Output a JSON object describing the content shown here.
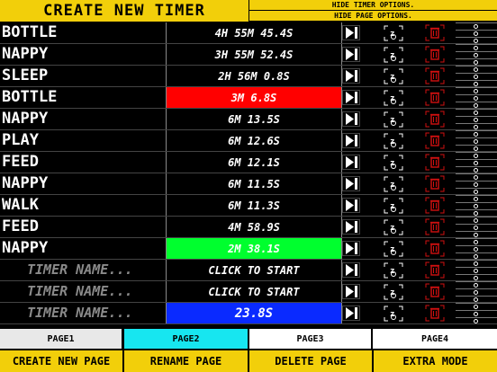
{
  "header": {
    "create_label": "CREATE NEW TIMER",
    "hide_timer_options": "HIDE TIMER OPTIONS.",
    "hide_page_options": "HIDE PAGE OPTIONS."
  },
  "rows": [
    {
      "name": "BOTTLE",
      "time": "4H 55M 45.4S",
      "placeholder": false,
      "highlight": ""
    },
    {
      "name": "NAPPY",
      "time": "3H 55M 52.4S",
      "placeholder": false,
      "highlight": ""
    },
    {
      "name": "SLEEP",
      "time": "2H 56M 0.8S",
      "placeholder": false,
      "highlight": ""
    },
    {
      "name": "BOTTLE",
      "time": "3M 6.8S",
      "placeholder": false,
      "highlight": "red"
    },
    {
      "name": "NAPPY",
      "time": "6M 13.5S",
      "placeholder": false,
      "highlight": ""
    },
    {
      "name": "PLAY",
      "time": "6M 12.6S",
      "placeholder": false,
      "highlight": ""
    },
    {
      "name": "FEED",
      "time": "6M 12.1S",
      "placeholder": false,
      "highlight": ""
    },
    {
      "name": "NAPPY",
      "time": "6M 11.5S",
      "placeholder": false,
      "highlight": ""
    },
    {
      "name": "WALK",
      "time": "6M 11.3S",
      "placeholder": false,
      "highlight": ""
    },
    {
      "name": "FEED",
      "time": "4M 58.9S",
      "placeholder": false,
      "highlight": ""
    },
    {
      "name": "NAPPY",
      "time": "2M 38.1S",
      "placeholder": false,
      "highlight": "green"
    },
    {
      "name": "TIMER NAME...",
      "time": "CLICK TO START",
      "placeholder": true,
      "highlight": ""
    },
    {
      "name": "TIMER NAME...",
      "time": "CLICK TO START",
      "placeholder": true,
      "highlight": ""
    },
    {
      "name": "TIMER NAME...",
      "time": "23.8S",
      "placeholder": true,
      "highlight": "blue"
    }
  ],
  "pages": [
    {
      "label": "PAGE1",
      "bg": "#e8e8e8"
    },
    {
      "label": "PAGE2",
      "bg": "#17e6f0"
    },
    {
      "label": "PAGE3",
      "bg": "#ffffff"
    },
    {
      "label": "PAGE4",
      "bg": "#ffffff"
    }
  ],
  "actions": [
    "CREATE NEW PAGE",
    "RENAME PAGE",
    "DELETE PAGE",
    "EXTRA MODE"
  ],
  "colors": {
    "accent": "#f2cf0a",
    "red": "#ff0000",
    "green": "#00ff2e",
    "blue": "#0a2aff",
    "trash": "#d01010"
  },
  "icons": {
    "play": "play-skip-icon",
    "sleep": "sleep-zzz-icon",
    "trash": "trash-icon",
    "dots": "dots-column-icon"
  }
}
